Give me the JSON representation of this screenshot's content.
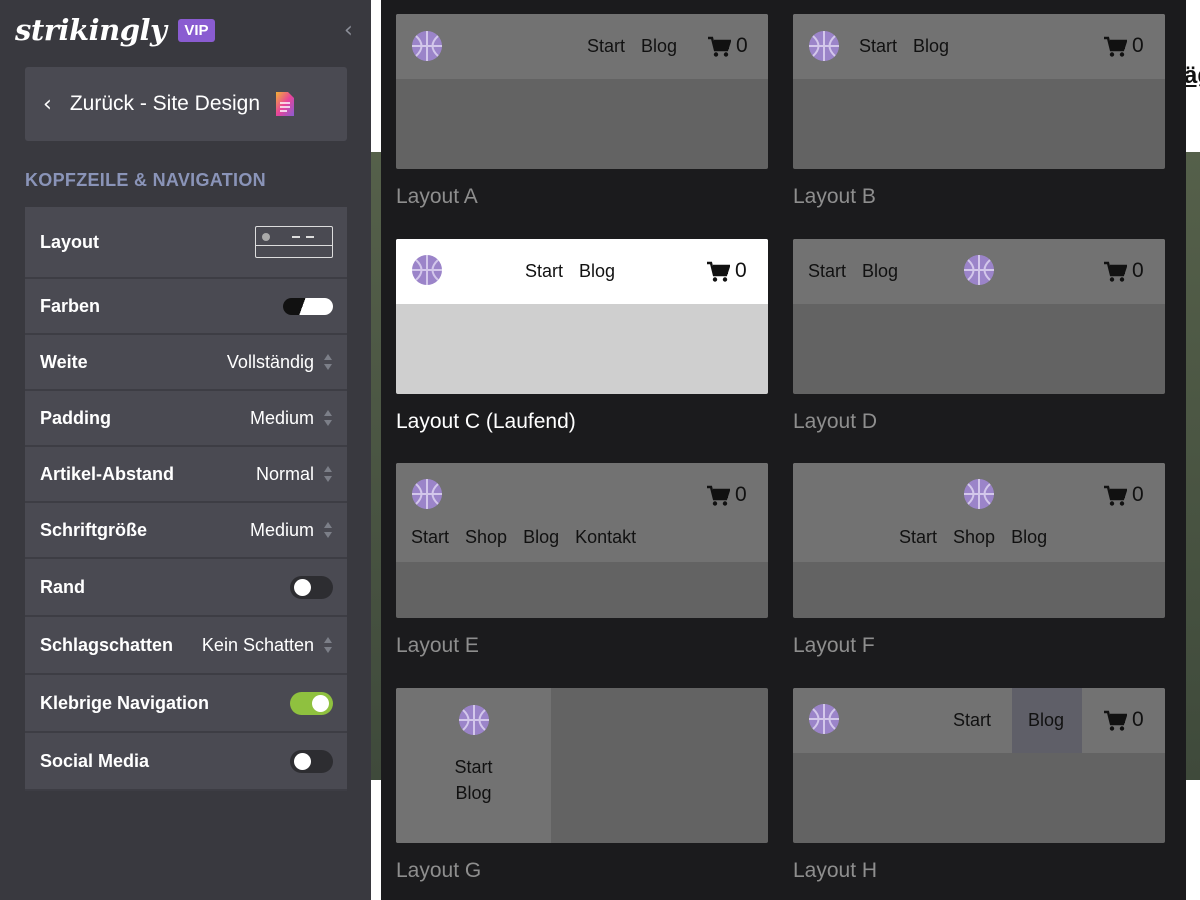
{
  "brand": {
    "logo_text": "strikingly",
    "badge": "VIP",
    "collapse_icon": "chevron-left-icon"
  },
  "back": {
    "label": "Zurück - Site Design",
    "icon": "chevron-left-icon",
    "doc_icon": "document-icon"
  },
  "section": {
    "title": "KOPFZEILE & NAVIGATION"
  },
  "settings": {
    "layout": {
      "label": "Layout"
    },
    "colors": {
      "label": "Farben"
    },
    "width": {
      "label": "Weite",
      "value": "Vollständig"
    },
    "padding": {
      "label": "Padding",
      "value": "Medium"
    },
    "spacing": {
      "label": "Artikel-Abstand",
      "value": "Normal"
    },
    "fontsize": {
      "label": "Schriftgröße",
      "value": "Medium"
    },
    "border": {
      "label": "Rand",
      "on": false
    },
    "shadow": {
      "label": "Schlagschatten",
      "value": "Kein Schatten"
    },
    "sticky": {
      "label": "Klebrige Navigation",
      "on": true
    },
    "social": {
      "label": "Social Media",
      "on": false
    }
  },
  "site": {
    "partial_text": "äg"
  },
  "layouts": {
    "a": {
      "label": "Layout A",
      "nav": [
        "Start",
        "Blog"
      ],
      "cart": "0"
    },
    "b": {
      "label": "Layout B",
      "nav": [
        "Start",
        "Blog"
      ],
      "cart": "0"
    },
    "c": {
      "label": "Layout C (Laufend)",
      "nav": [
        "Start",
        "Blog"
      ],
      "cart": "0",
      "active": true
    },
    "d": {
      "label": "Layout D",
      "nav": [
        "Start",
        "Blog"
      ],
      "cart": "0"
    },
    "e": {
      "label": "Layout E",
      "nav": [
        "Start",
        "Shop",
        "Blog",
        "Kontakt"
      ],
      "cart": "0"
    },
    "f": {
      "label": "Layout F",
      "nav": [
        "Start",
        "Shop",
        "Blog"
      ],
      "cart": "0"
    },
    "g": {
      "label": "Layout G",
      "nav": [
        "Start",
        "Blog"
      ]
    },
    "h": {
      "label": "Layout H",
      "nav": [
        "Start",
        "Blog"
      ],
      "cart": "0"
    }
  },
  "colors": {
    "sidebar": "#39393f",
    "accent": "#8a5cd1",
    "toggle_on": "#8fc13f",
    "logo_purple": "#9b84c9"
  }
}
